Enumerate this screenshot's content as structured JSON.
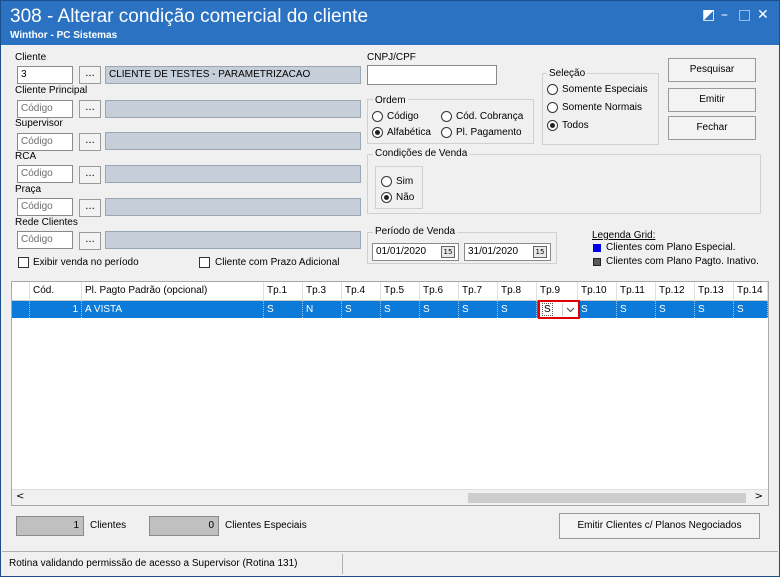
{
  "window": {
    "title": "308 - Alterar condição comercial do cliente",
    "subtitle": "Winthor - PC Sistemas",
    "controls": {
      "restore": "◩",
      "minimize": "–",
      "maximize": "□",
      "close": "✕"
    }
  },
  "filters": {
    "cliente": {
      "label": "Cliente",
      "code": "3",
      "button": "...",
      "name": "CLIENTE DE TESTES - PARAMETRIZACAO"
    },
    "cliente_principal": {
      "label": "Cliente Principal",
      "placeholder": "Código",
      "button": "..."
    },
    "supervisor": {
      "label": "Supervisor",
      "placeholder": "Código",
      "button": "..."
    },
    "rca": {
      "label": "RCA",
      "placeholder": "Código",
      "button": "..."
    },
    "praca": {
      "label": "Praça",
      "placeholder": "Código",
      "button": "..."
    },
    "rede_clientes": {
      "label": "Rede Clientes",
      "placeholder": "Código",
      "button": "..."
    },
    "exibir_venda": "Exibir venda no período",
    "cliente_prazo": "Cliente com Prazo Adicional",
    "cnpj_label": "CNPJ/CPF",
    "cnpj_value": ""
  },
  "ordem": {
    "title": "Ordem",
    "options": [
      "Código",
      "Cód. Cobrança",
      "Alfabética",
      "Pl. Pagamento"
    ],
    "selected": "Alfabética"
  },
  "selecao": {
    "title": "Seleção",
    "options": [
      "Somente Especiais",
      "Somente Normais",
      "Todos"
    ],
    "selected": "Todos"
  },
  "condicoes": {
    "title": "Condições de Venda",
    "options": [
      "Sim",
      "Não"
    ],
    "selected": "Não"
  },
  "periodo": {
    "title": "Período de Venda",
    "start": "01/01/2020",
    "end": "31/01/2020",
    "calendar_icon": "15"
  },
  "buttons": {
    "pesquisar": "Pesquisar",
    "emitir": "Emitir",
    "fechar": "Fechar",
    "emitir_planos": "Emitir Clientes c/ Planos Negociados"
  },
  "legend": {
    "title": "Legenda Grid:",
    "items": [
      {
        "label": "Clientes com Plano Especial.",
        "color": "#0000e6"
      },
      {
        "label": "Clientes com Plano Pagto. Inativo.",
        "color": "#5a5a5a"
      }
    ]
  },
  "grid": {
    "columns": [
      "Cód.",
      "Pl. Pagto Padrão (opcional)",
      "Tp.1",
      "Tp.3",
      "Tp.4",
      "Tp.5",
      "Tp.6",
      "Tp.7",
      "Tp.8",
      "Tp.9",
      "Tp.10",
      "Tp.11",
      "Tp.12",
      "Tp.13",
      "Tp.14"
    ],
    "rows": [
      [
        "1",
        "A VISTA",
        "S",
        "N",
        "S",
        "S",
        "S",
        "S",
        "S",
        "S",
        "S",
        "S",
        "S",
        "S",
        "S"
      ]
    ],
    "dropdown_icon": "chevron-down-icon",
    "scroll_left": "<",
    "scroll_right": ">"
  },
  "summary": {
    "clientes_count": "1",
    "clientes_label": "Clientes",
    "especiais_count": "0",
    "especiais_label": "Clientes Especiais"
  },
  "status": {
    "text": "Rotina validando permissão de acesso a Supervisor (Rotina 131)"
  },
  "colors": {
    "titlebar": "#2b72c2",
    "selected_row": "#0c7ad8",
    "highlight_border": "#e00000"
  }
}
